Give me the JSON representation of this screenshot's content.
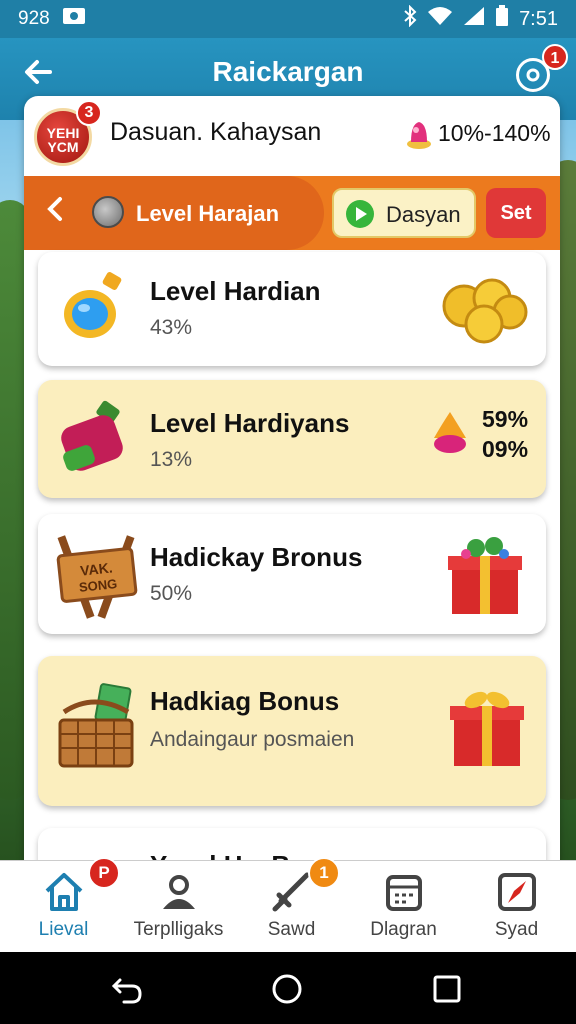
{
  "status_bar": {
    "time_left": "928",
    "time_right": "7:51"
  },
  "app_bar": {
    "title": "Raickargan",
    "notification_count": "1"
  },
  "user": {
    "avatar_text": "YEHI\nYCM",
    "avatar_badge": "3",
    "name": "Dasuan. Kahaysan",
    "percent": "10%-140%"
  },
  "level_strip": {
    "level_label": "Level Harajan",
    "play_label": "Dasyan",
    "set_label": "Set"
  },
  "cards": [
    {
      "title": "Level Hardian",
      "sub": "43%"
    },
    {
      "title": "Level Hardiyans",
      "sub": "13%",
      "right_top": "59%",
      "right_bottom": "09%"
    },
    {
      "title": "Hadickay Bronus",
      "sub": "50%",
      "sign_text": "VAK. SONG"
    },
    {
      "title": "Hadkiag Bonus",
      "sub": "Andaingaur posmaien"
    },
    {
      "title": "Yavel HayBanus"
    }
  ],
  "bottom_nav": [
    {
      "label": "Lieval",
      "badge": "P"
    },
    {
      "label": "Terplligaks"
    },
    {
      "label": "Sawd",
      "badge": "1"
    },
    {
      "label": "Dlagran"
    },
    {
      "label": "Syad"
    }
  ],
  "colors": {
    "primary": "#1e82ad",
    "accent": "#ec7a1e",
    "cream": "#fbeebe",
    "badge_red": "#d7261e"
  }
}
